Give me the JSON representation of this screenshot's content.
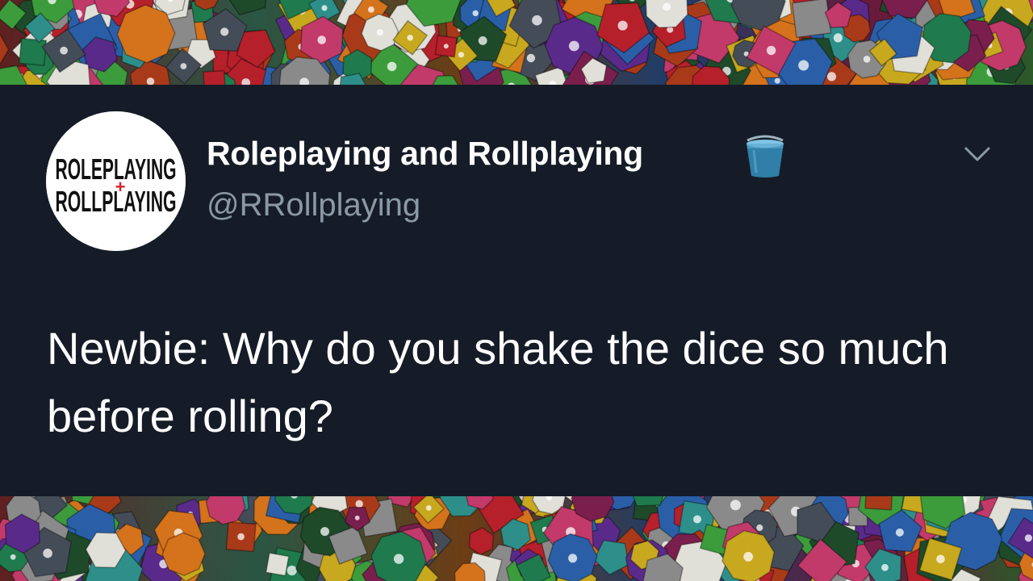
{
  "tweet": {
    "display_name": "Roleplaying and Rollplaying",
    "handle": "@RRollplaying",
    "text": "Newbie: Why do you shake the dice so much before rolling?"
  },
  "avatar": {
    "logo_line_1": "ROLEPLAYING",
    "logo_line_2": "ROLLPLAYING",
    "logo_symbol": "+"
  },
  "icons": {
    "name_emoji": "bucket-icon",
    "menu": "chevron-down-icon"
  },
  "colors": {
    "background": "#151c27",
    "display_name": "#ffffff",
    "handle": "#8b98a5",
    "logo_accent": "#d9232e"
  }
}
